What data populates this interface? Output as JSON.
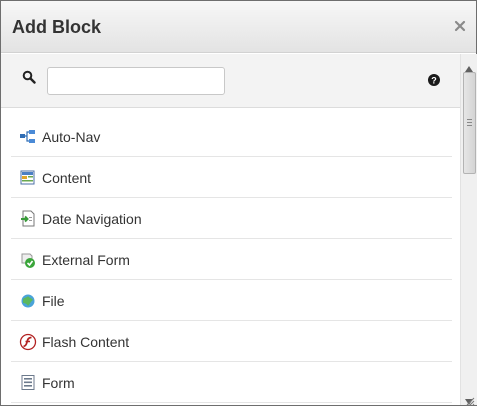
{
  "dialog": {
    "title": "Add Block",
    "close_icon": "close-icon"
  },
  "search": {
    "icon": "search-icon",
    "value": "",
    "placeholder": "",
    "help_icon": "help-icon"
  },
  "blocks": [
    {
      "label": "Auto-Nav",
      "icon": "auto-nav-icon"
    },
    {
      "label": "Content",
      "icon": "content-icon"
    },
    {
      "label": "Date Navigation",
      "icon": "date-navigation-icon"
    },
    {
      "label": "External Form",
      "icon": "external-form-icon"
    },
    {
      "label": "File",
      "icon": "file-icon"
    },
    {
      "label": "Flash Content",
      "icon": "flash-content-icon"
    },
    {
      "label": "Form",
      "icon": "form-icon"
    }
  ],
  "colors": {
    "title_bar": "#e8e8e8",
    "toolbar_bg": "#f3f3f3",
    "text": "#333333",
    "border": "#6e6e6e"
  }
}
